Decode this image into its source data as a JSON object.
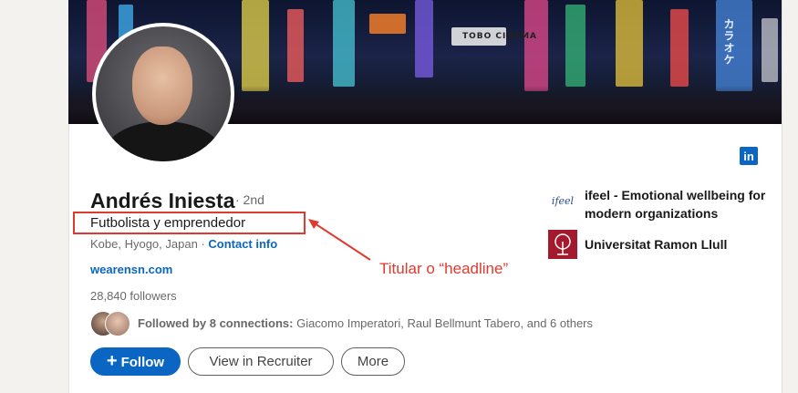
{
  "profile": {
    "name": "Andrés Iniesta",
    "degree": "· 2nd",
    "headline": "Futbolista y emprendedor",
    "location": "Kobe, Hyogo, Japan · ",
    "contact_label": "Contact info",
    "website": "wearensn.com",
    "followers": "28,840 followers",
    "followed_prefix": "Followed by 8 connections:",
    "followed_names": " Giacomo Imperatori, Raul Bellmunt Tabero, and 6 others"
  },
  "actions": {
    "follow": "Follow",
    "follow_icon": "+",
    "recruiter": "View in Recruiter",
    "more": "More"
  },
  "experience": [
    {
      "logo": "ifeel-logo",
      "logo_text": "ifeel",
      "name": "ifeel - Emotional wellbeing for modern organizations"
    },
    {
      "logo": "universitat-ramon-llull-logo",
      "name": "Universitat Ramon Llull"
    }
  ],
  "banner": {
    "signs": [
      "TOBO CINEMA",
      "カラオケ"
    ]
  },
  "social_icon": "in",
  "annotation": {
    "label": "Titular o “headline”",
    "color": "#e03a2f"
  },
  "colors": {
    "brand": "#0a66c2",
    "page_bg": "#f3f2ef"
  }
}
